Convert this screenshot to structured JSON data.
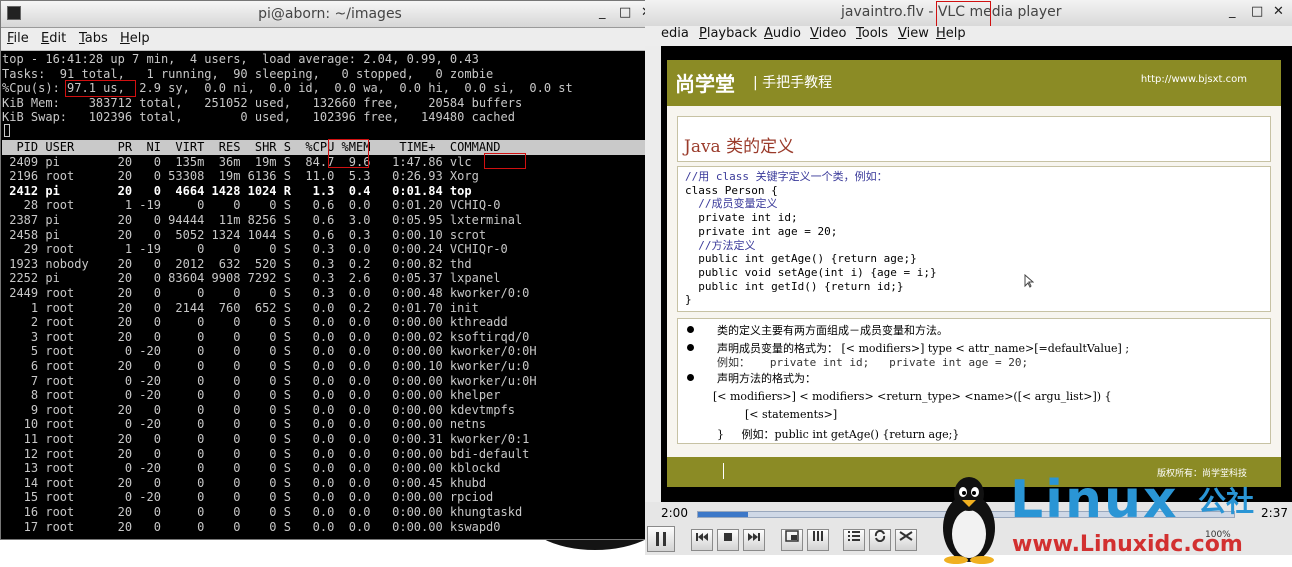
{
  "terminal": {
    "title": "pi@aborn: ~/images",
    "controls": [
      "_",
      "□",
      "✕"
    ],
    "menu": [
      {
        "key": "F",
        "rest": "ile"
      },
      {
        "key": "E",
        "rest": "dit"
      },
      {
        "key": "T",
        "rest": "abs"
      },
      {
        "key": "H",
        "rest": "elp"
      }
    ],
    "summary": [
      "top - 16:41:28 up 7 min,  4 users,  load average: 2.04, 0.99, 0.43",
      "Tasks:  91 total,   1 running,  90 sleeping,   0 stopped,   0 zombie",
      "%Cpu(s): 97.1 us,  2.9 sy,  0.0 ni,  0.0 id,  0.0 wa,  0.0 hi,  0.0 si,  0.0 st",
      "KiB Mem:    383712 total,   251052 used,   132660 free,    20584 buffers",
      "KiB Swap:   102396 total,        0 used,   102396 free,   149480 cached"
    ],
    "header": "  PID USER      PR  NI  VIRT  RES  SHR S  %CPU %MEM    TIME+  COMMAND",
    "processes": [
      " 2409 pi        20   0  135m  36m  19m S  84.7  9.6   1:47.86 vlc",
      " 2196 root      20   0 53308  19m 6136 S  11.0  5.3   0:26.93 Xorg",
      " 2412 pi        20   0  4664 1428 1024 R   1.3  0.4   0:01.84 top",
      "   28 root       1 -19     0    0    0 S   0.6  0.0   0:01.20 VCHIQ-0",
      " 2387 pi        20   0 94444  11m 8256 S   0.6  3.0   0:05.95 lxterminal",
      " 2458 pi        20   0  5052 1324 1044 S   0.6  0.3   0:00.10 scrot",
      "   29 root       1 -19     0    0    0 S   0.3  0.0   0:00.24 VCHIQr-0",
      " 1923 nobody    20   0  2012  632  520 S   0.3  0.2   0:00.82 thd",
      " 2252 pi        20   0 83604 9908 7292 S   0.3  2.6   0:05.37 lxpanel",
      " 2449 root      20   0     0    0    0 S   0.3  0.0   0:00.48 kworker/0:0",
      "    1 root      20   0  2144  760  652 S   0.0  0.2   0:01.70 init",
      "    2 root      20   0     0    0    0 S   0.0  0.0   0:00.00 kthreadd",
      "    3 root      20   0     0    0    0 S   0.0  0.0   0:00.02 ksoftirqd/0",
      "    5 root       0 -20     0    0    0 S   0.0  0.0   0:00.00 kworker/0:0H",
      "    6 root      20   0     0    0    0 S   0.0  0.0   0:00.10 kworker/u:0",
      "    7 root       0 -20     0    0    0 S   0.0  0.0   0:00.00 kworker/u:0H",
      "    8 root       0 -20     0    0    0 S   0.0  0.0   0:00.00 khelper",
      "    9 root      20   0     0    0    0 S   0.0  0.0   0:00.00 kdevtmpfs",
      "   10 root       0 -20     0    0    0 S   0.0  0.0   0:00.00 netns",
      "   11 root      20   0     0    0    0 S   0.0  0.0   0:00.31 kworker/0:1",
      "   12 root      20   0     0    0    0 S   0.0  0.0   0:00.00 bdi-default",
      "   13 root       0 -20     0    0    0 S   0.0  0.0   0:00.00 kblockd",
      "   14 root      20   0     0    0    0 S   0.0  0.0   0:00.45 khubd",
      "   15 root       0 -20     0    0    0 S   0.0  0.0   0:00.00 rpciod",
      "   16 root      20   0     0    0    0 S   0.0  0.0   0:00.00 khungtaskd",
      "   17 root      20   0     0    0    0 S   0.0  0.0   0:00.00 kswapd0"
    ],
    "highlight_color": "#d01010"
  },
  "vlc": {
    "title": "javaintro.flv - VLC media player",
    "controls": [
      "_",
      "□",
      "✕"
    ],
    "menu": [
      {
        "key": "",
        "rest": "edia"
      },
      {
        "key": "P",
        "rest": "layback"
      },
      {
        "key": "A",
        "rest": "udio"
      },
      {
        "key": "V",
        "rest": "ideo"
      },
      {
        "key": "T",
        "rest": "ools"
      },
      {
        "key": "V",
        "rest": "iew"
      },
      {
        "key": "H",
        "rest": "elp"
      }
    ],
    "slide": {
      "logo": "尚学堂",
      "subtitle": "| 手把手教程",
      "url": "http://www.bjsxt.com",
      "heading": "Java  类的定义",
      "code": [
        {
          "t": "//用 class 关键字定义一个类，例如：",
          "c": "c-comment"
        },
        {
          "t": "class Person {",
          "c": "c-norm"
        },
        {
          "t": "  //成员变量定义",
          "c": "c-comment"
        },
        {
          "t": "  private int id;",
          "c": "c-norm"
        },
        {
          "t": "  private int age = 20;",
          "c": "c-norm"
        },
        {
          "t": "  //方法定义",
          "c": "c-comment"
        },
        {
          "t": "  public int getAge() {return age;}",
          "c": "c-norm"
        },
        {
          "t": "  public void setAge(int i) {age = i;}",
          "c": "c-norm"
        },
        {
          "t": "  public int getId() {return id;}",
          "c": "c-norm"
        },
        {
          "t": "}",
          "c": "c-norm"
        }
      ],
      "bullet1": "类的定义主要有两方面组成－成员变量和方法。",
      "bullet2": "声明成员变量的格式为： [< modifiers>] type < attr_name>[=defaultValue] ;",
      "bullet2_example": "例如：   private int id;   private int age = 20;",
      "bullet3": "声明方法的格式为：",
      "method1": "[< modifiers>] < modifiers> <return_type> <name>([< argu_list>]) {",
      "method2": "[< statements>]",
      "method3": "}     例如：public int getAge() {return age;}",
      "footer": "版权所有：尚学堂科技"
    },
    "time_elapsed": "2:00",
    "time_total": "2:37",
    "progress": 0.093,
    "volume": "100%"
  },
  "watermark": {
    "brand": "Linux",
    "brand_cn": "公社",
    "url": "www.Linuxidc.com"
  }
}
